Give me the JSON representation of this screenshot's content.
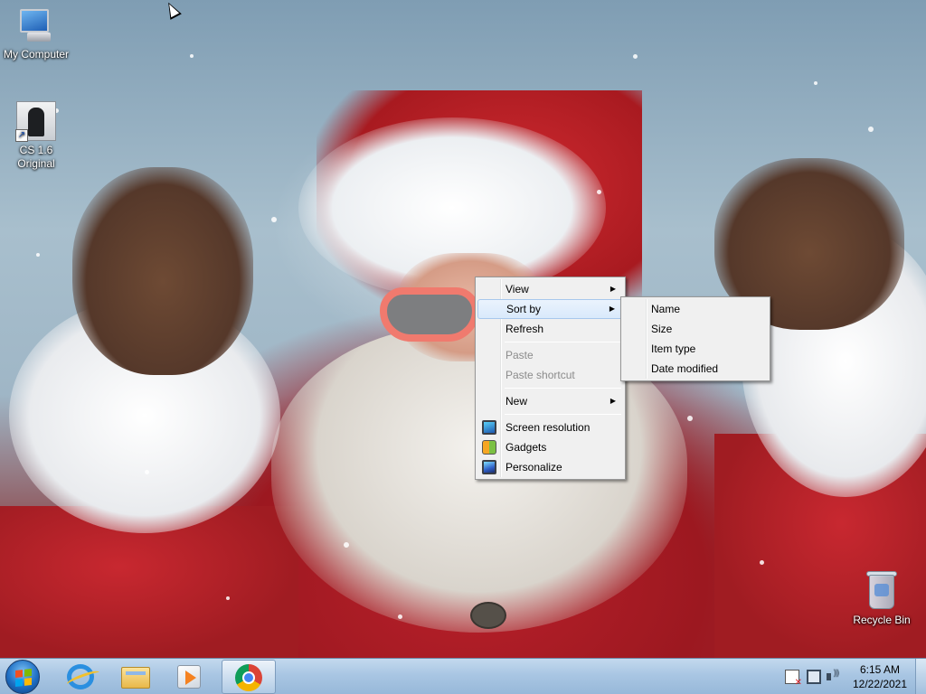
{
  "desktop": {
    "icons": [
      {
        "label": "My Computer",
        "icon": "computer-icon"
      },
      {
        "label": "CS 1.6 Original",
        "label_line1": "CS 1.6",
        "label_line2": "Original",
        "icon": "cs-shortcut-icon"
      },
      {
        "label": "Recycle Bin",
        "icon": "recycle-bin-icon"
      }
    ]
  },
  "context_menu": {
    "items": [
      {
        "label": "View",
        "has_submenu": true,
        "enabled": true
      },
      {
        "label": "Sort by",
        "has_submenu": true,
        "enabled": true,
        "highlighted": true
      },
      {
        "label": "Refresh",
        "enabled": true
      },
      {
        "label": "Paste",
        "enabled": false
      },
      {
        "label": "Paste shortcut",
        "enabled": false
      },
      {
        "label": "New",
        "has_submenu": true,
        "enabled": true
      },
      {
        "label": "Screen resolution",
        "icon": "screen-resolution-icon",
        "enabled": true
      },
      {
        "label": "Gadgets",
        "icon": "gadgets-icon",
        "enabled": true
      },
      {
        "label": "Personalize",
        "icon": "personalize-icon",
        "enabled": true
      }
    ],
    "submenu_arrow": "▶"
  },
  "sort_submenu": {
    "items": [
      {
        "label": "Name"
      },
      {
        "label": "Size"
      },
      {
        "label": "Item type"
      },
      {
        "label": "Date modified"
      }
    ]
  },
  "taskbar": {
    "pinned": [
      {
        "name": "Internet Explorer",
        "icon": "internet-explorer-icon"
      },
      {
        "name": "Windows Explorer",
        "icon": "folder-icon"
      },
      {
        "name": "Windows Media Player",
        "icon": "media-player-icon"
      },
      {
        "name": "Google Chrome",
        "icon": "chrome-icon",
        "active": true
      }
    ],
    "tray": {
      "icons": [
        "action-center-flag-icon",
        "network-icon",
        "volume-icon"
      ],
      "time": "6:15 AM",
      "date": "12/22/2021"
    }
  }
}
